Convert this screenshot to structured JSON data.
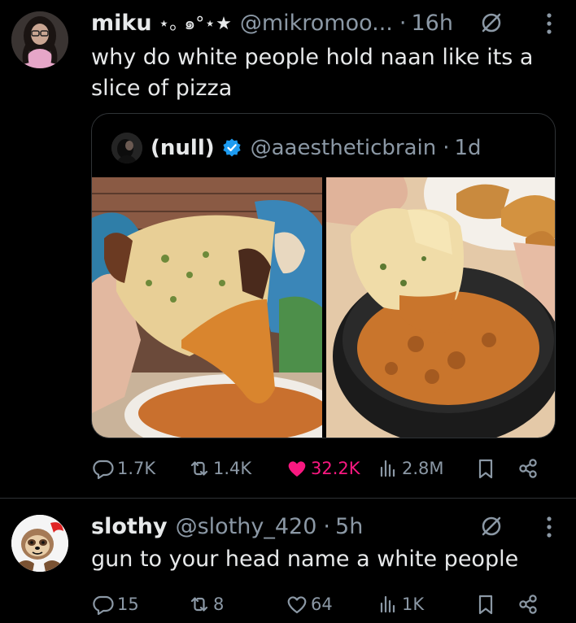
{
  "tweets": [
    {
      "name": "miku",
      "name_deco": "⋆｡ ๑°⋆★",
      "handle": "@mikromoo...",
      "time": "16h",
      "text": "why do white people hold naan like its a slice of pizza",
      "quote": {
        "name": "(null)",
        "handle": "@aaestheticbrain",
        "time": "1d"
      },
      "actions": {
        "replies": "1.7K",
        "reposts": "1.4K",
        "likes": "32.2K",
        "views": "2.8M"
      }
    },
    {
      "name": "slothy",
      "handle": "@slothy_420",
      "time": "5h",
      "text": "gun to your head name a white people",
      "actions": {
        "replies": "15",
        "reposts": "8",
        "likes": "64",
        "views": "1K"
      }
    }
  ],
  "colors": {
    "background": "#000000",
    "text": "#e7e9ea",
    "secondary": "#8b98a5",
    "like": "#f91880",
    "verified": "#1d9bf0"
  },
  "icons": [
    "reply-icon",
    "repost-icon",
    "like-icon",
    "views-icon",
    "bookmark-icon",
    "share-icon",
    "grok-icon",
    "more-icon",
    "verified-badge"
  ]
}
